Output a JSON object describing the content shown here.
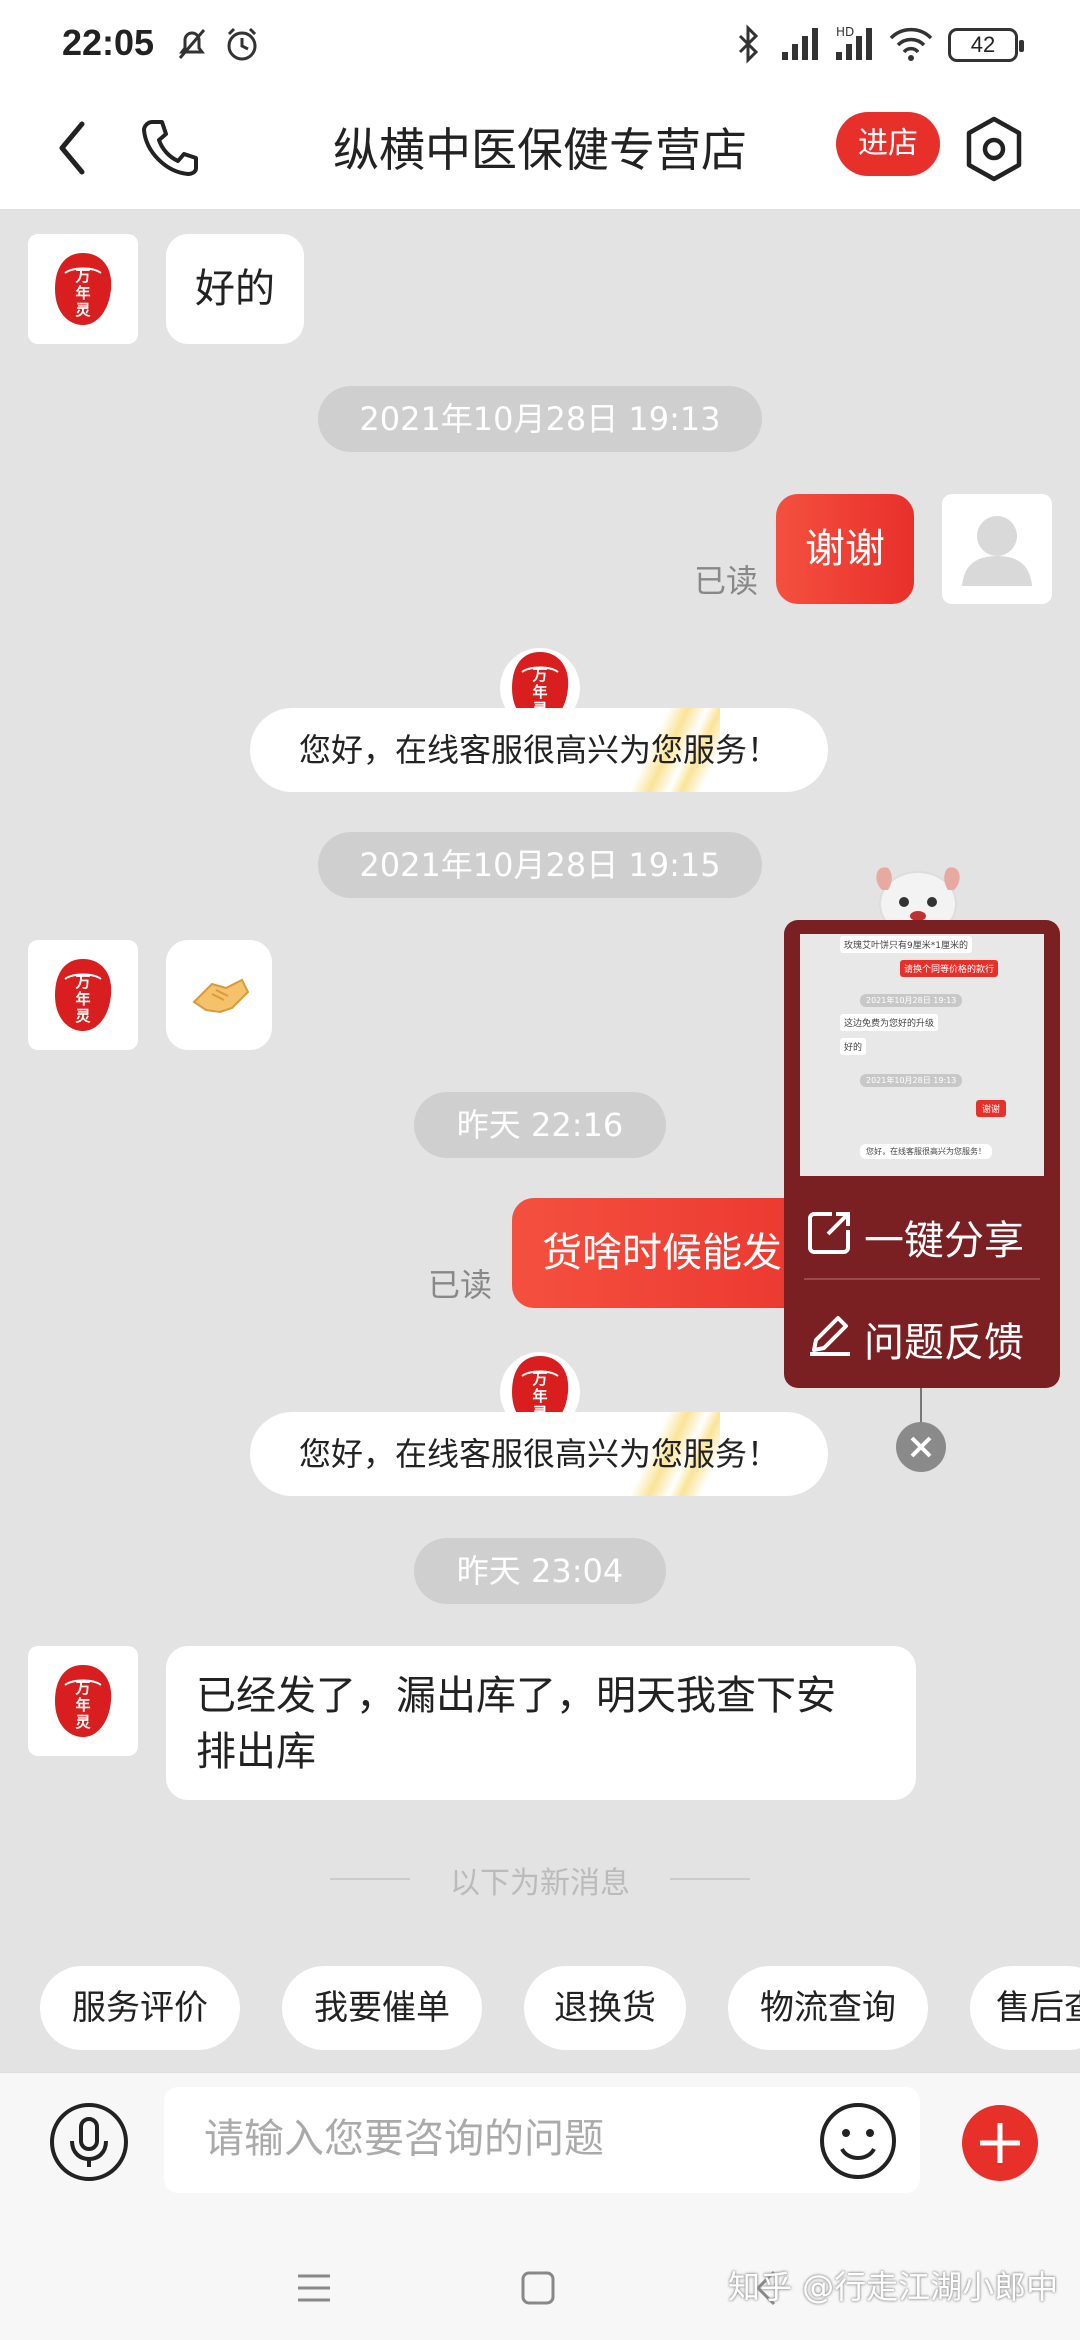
{
  "status_bar": {
    "time": "22:05",
    "battery": "42"
  },
  "header": {
    "title": "纵横中医保健专营店",
    "enter_shop": "进店"
  },
  "chat": {
    "shop_logo_text": "万年灵",
    "messages": [
      {
        "type": "incoming",
        "text": "好的"
      },
      {
        "type": "time",
        "text": "2021年10月28日  19:13"
      },
      {
        "type": "outgoing",
        "text": "谢谢",
        "read": "已读"
      },
      {
        "type": "system",
        "text": "您好，在线客服很高兴为您服务！"
      },
      {
        "type": "time",
        "text": "2021年10月28日  19:15"
      },
      {
        "type": "incoming_emoji",
        "text": "🤝"
      },
      {
        "type": "time",
        "text": "昨天  22:16"
      },
      {
        "type": "outgoing",
        "text": "货啥时候能发",
        "read": "已读"
      },
      {
        "type": "system",
        "text": "您好，在线客服很高兴为您服务！"
      },
      {
        "type": "time",
        "text": "昨天  23:04"
      },
      {
        "type": "incoming",
        "text_line1": "已经发了，漏出库了，明天我查下安",
        "text_line2": "排出库"
      }
    ],
    "new_messages_divider": "以下为新消息"
  },
  "quick_actions": [
    "服务评价",
    "我要催单",
    "退换货",
    "物流查询",
    "售后查"
  ],
  "input": {
    "placeholder": "请输入您要咨询的问题"
  },
  "float_panel": {
    "share": "一键分享",
    "feedback": "问题反馈",
    "preview": {
      "line1": "玫瑰艾叶饼只有9厘米*1厘米的",
      "line2": "请换个同等价格的款行",
      "time1": "2021年10月28日  19:13",
      "line3": "这边免费为您好的升级",
      "line4": "好的",
      "time2": "2021年10月28日  19:13",
      "line5": "谢谢",
      "line6": "您好，在线客服很高兴为您服务！"
    }
  },
  "watermark": "知乎 @行走江湖小郎中",
  "colors": {
    "accent": "#e8302b",
    "background": "#e3e3e3",
    "panel": "#7a1f22"
  }
}
